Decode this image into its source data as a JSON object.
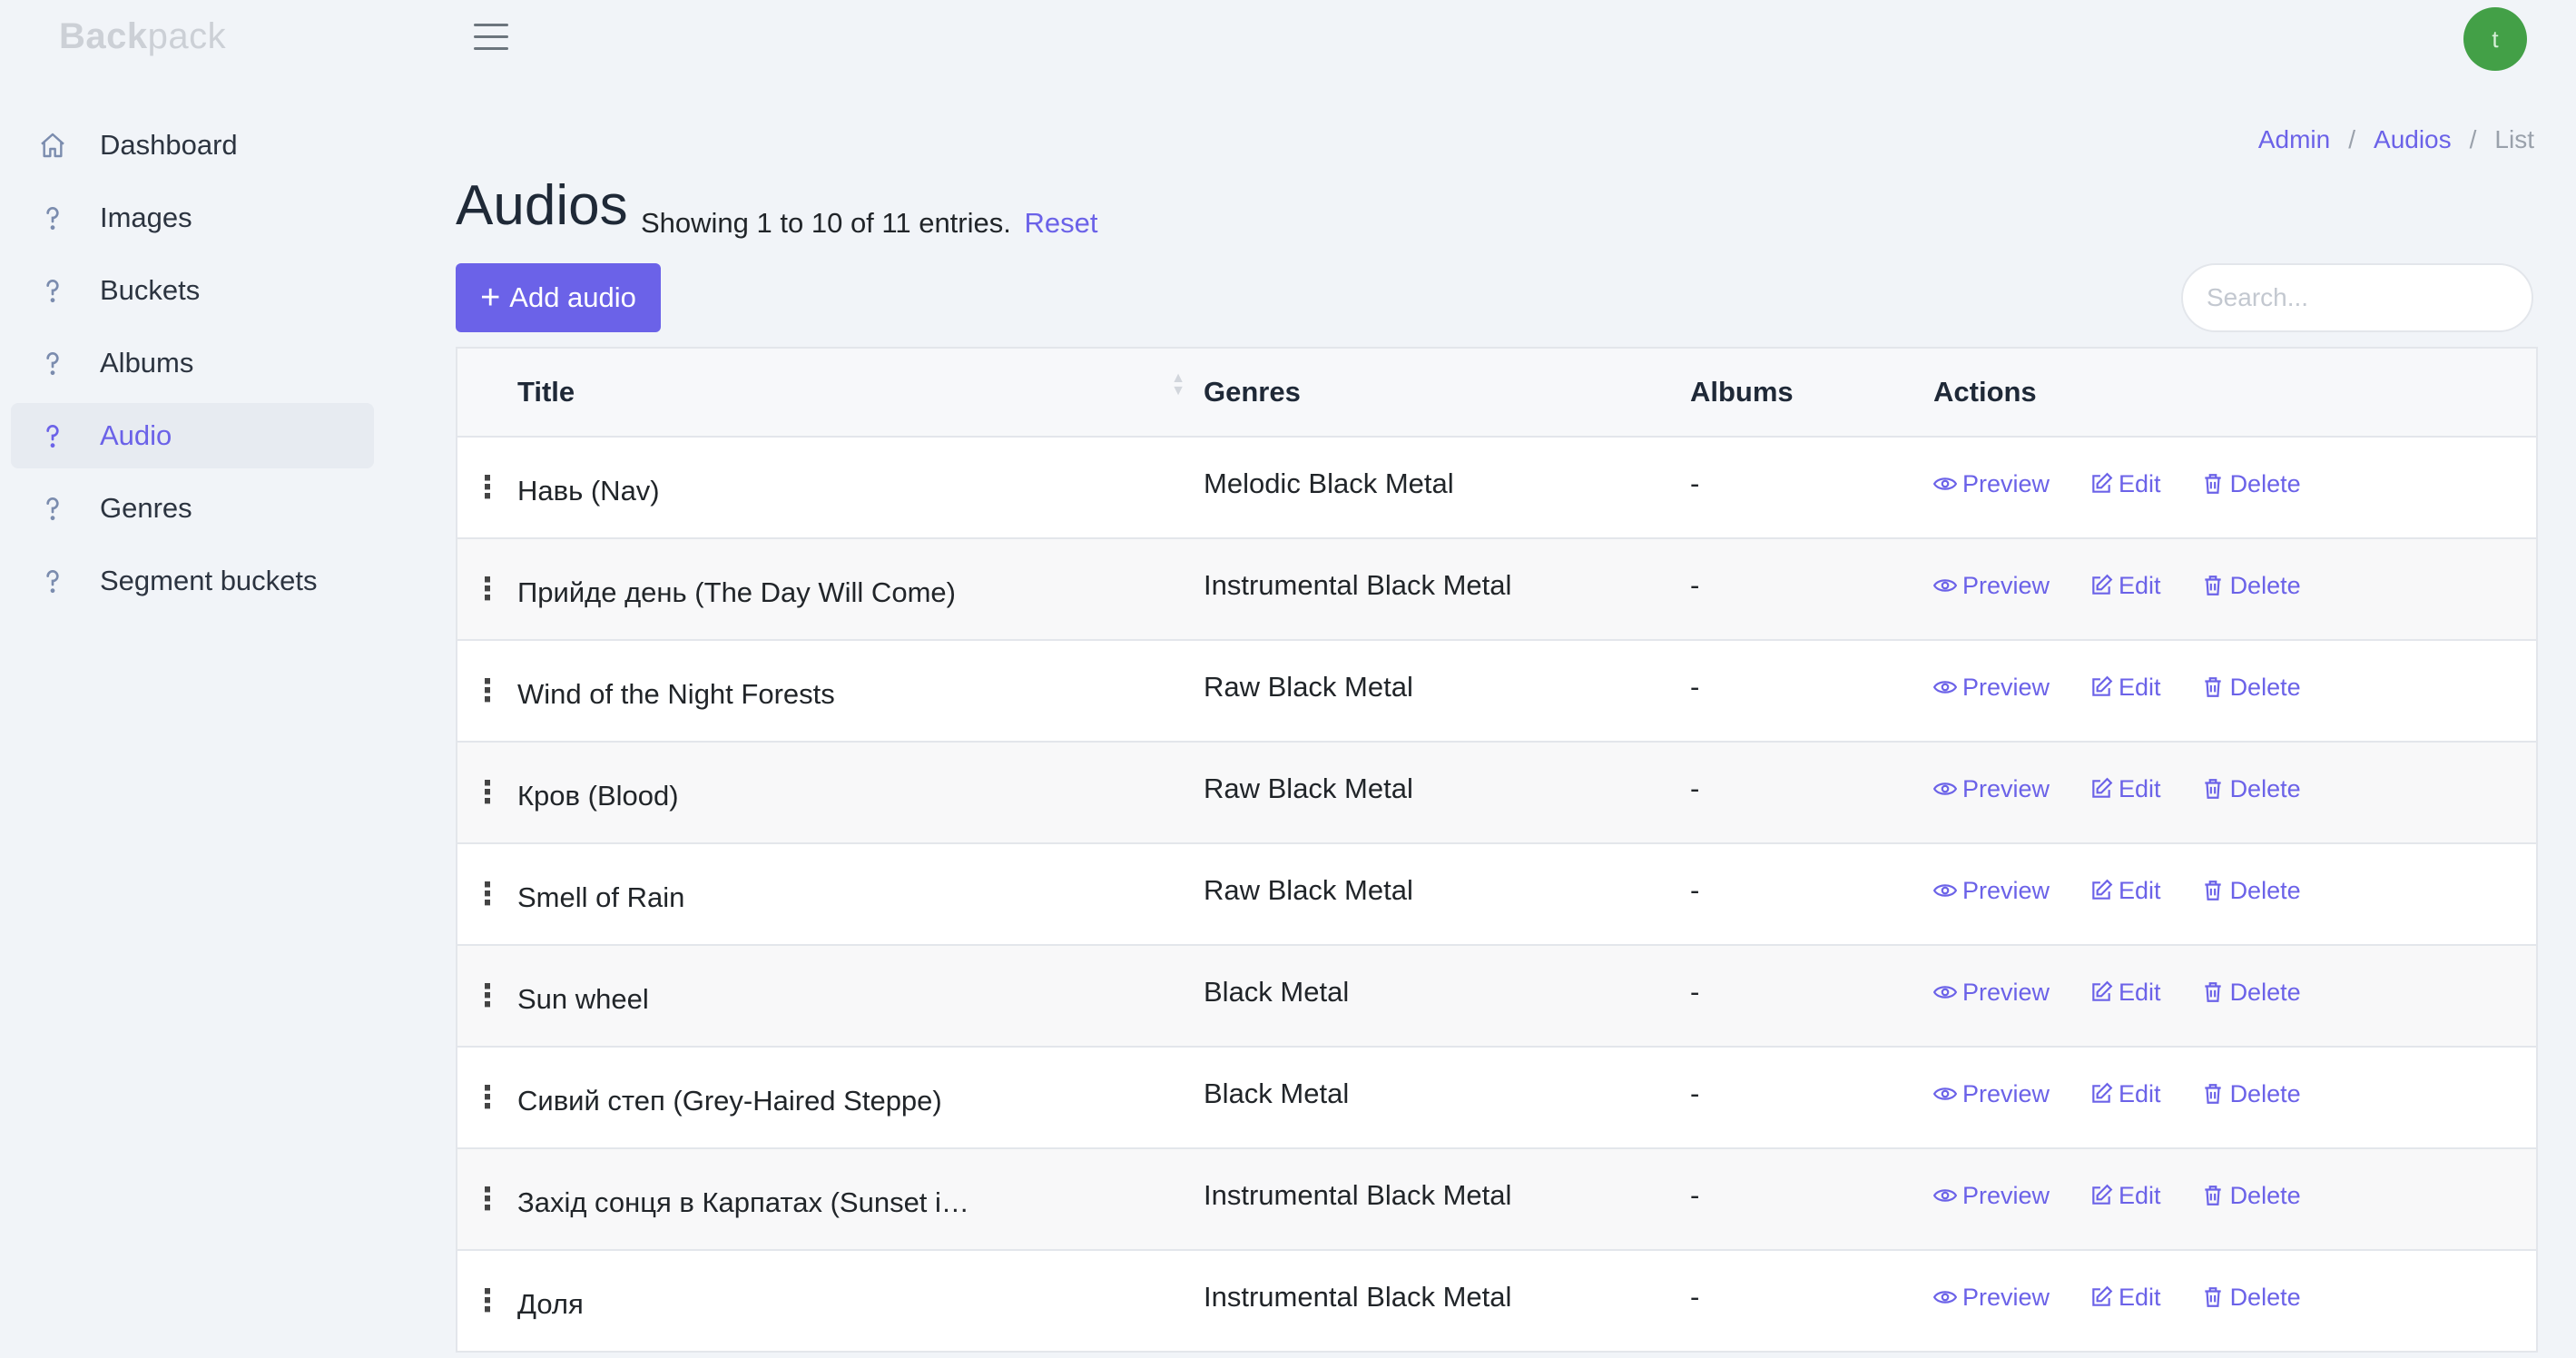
{
  "brand": {
    "bold": "Back",
    "thin": "pack"
  },
  "user": {
    "initial": "t"
  },
  "sidebar": {
    "items": [
      {
        "label": "Dashboard",
        "icon": "home-icon"
      },
      {
        "label": "Images",
        "icon": "question-icon"
      },
      {
        "label": "Buckets",
        "icon": "question-icon"
      },
      {
        "label": "Albums",
        "icon": "question-icon"
      },
      {
        "label": "Audio",
        "icon": "question-icon",
        "active": true
      },
      {
        "label": "Genres",
        "icon": "question-icon"
      },
      {
        "label": "Segment buckets",
        "icon": "question-icon"
      }
    ]
  },
  "breadcrumb": {
    "items": [
      "Admin",
      "Audios",
      "List"
    ],
    "separator": "/"
  },
  "header": {
    "title": "Audios",
    "showing": "Showing 1 to 10 of 11 entries.",
    "reset": "Reset",
    "add_label": "Add audio",
    "search_placeholder": "Search..."
  },
  "table": {
    "columns": [
      "Title",
      "Genres",
      "Albums",
      "Actions"
    ],
    "actions": {
      "preview": "Preview",
      "edit": "Edit",
      "delete": "Delete"
    },
    "rows": [
      {
        "title": "Навь (Nav)",
        "genres": "Melodic Black Metal",
        "albums": "-"
      },
      {
        "title": "Прийде день (The Day Will Come)",
        "genres": "Instrumental Black Metal",
        "albums": "-"
      },
      {
        "title": "Wind of the Night Forests",
        "genres": "Raw Black Metal",
        "albums": "-"
      },
      {
        "title": "Кров (Blood)",
        "genres": "Raw Black Metal",
        "albums": "-"
      },
      {
        "title": "Smell of Rain",
        "genres": "Raw Black Metal",
        "albums": "-"
      },
      {
        "title": "Sun wheel",
        "genres": "Black Metal",
        "albums": "-"
      },
      {
        "title": "Сивий степ (Grey-Haired Steppe)",
        "genres": "Black Metal",
        "albums": "-"
      },
      {
        "title": "Захід сонця в Карпатах (Sunset i…",
        "genres": "Instrumental Black Metal",
        "albums": "-"
      },
      {
        "title": "Доля",
        "genres": "Instrumental Black Metal",
        "albums": "-"
      }
    ]
  },
  "colors": {
    "accent": "#6b62e8",
    "avatar": "#43a047",
    "background": "#f1f4f8"
  }
}
